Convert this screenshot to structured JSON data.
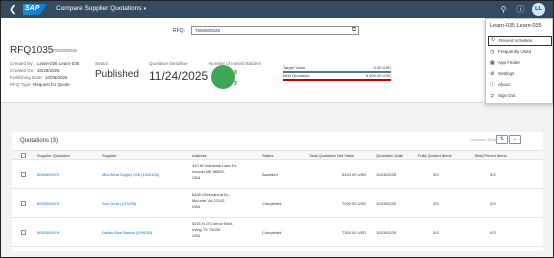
{
  "shell": {
    "back_icon": "back-arrow-icon",
    "logo_text": "SAP",
    "title": "Compare Supplier Quotations",
    "search_icon": "search-icon",
    "help_icon": "help-icon",
    "avatar_initials": "LL"
  },
  "header": {
    "rfq_label": "RFQ:",
    "rfq_value": "7000000025",
    "title": "RFQ1035",
    "subtitle": "7000000025",
    "created_by_label": "Created By:",
    "created_by_value": "Learn-035 Learn-035",
    "created_on_label": "Created On:",
    "created_on_value": "10/25/2025",
    "publishing_date_label": "Publishing Date:",
    "publishing_date_value": "10/25/2025",
    "rfq_type_label": "RFQ Type:",
    "rfq_type_value": "Request for Quote",
    "status_label": "Status:",
    "status_value": "Published",
    "deadline_label": "Quotation Deadline",
    "deadline_value": "11/24/2025",
    "bidders_label": "Number of Invited Bidders",
    "bidders_count_1": "3",
    "bidders_count_2": "3",
    "target_value_label": "Target Value",
    "target_value": "0.00 USD",
    "best_quotation_label": "Best Quotation",
    "best_quotation": "6,400.00 USD",
    "target_color": "#5b738b",
    "best_color": "#bb0000"
  },
  "table": {
    "title": "Quotations (3)",
    "compare_label": "Compare",
    "reset_label": "Reset",
    "columns": [
      "Supplier Quotation",
      "Supplier",
      "Address",
      "Status",
      "Total Quotation Net Value",
      "Quotation Date",
      "Fully Quoted Items",
      "Best-Priced Items"
    ],
    "rows": [
      {
        "quotation": "8000000072",
        "supplier": "Mid-West Supply 035 (1003163)",
        "address_1": "310 W Industrial Lake Dr,",
        "address_2": "Lincoln NE 68528,",
        "address_3": "USA",
        "status": "Awarded",
        "net_value": "6400.00 USD",
        "date": "10/25/2025",
        "fully_quoted": "3/3",
        "best_priced": "3/3"
      },
      {
        "quotation": "8000000073",
        "supplier": "Sun Gear (107035)",
        "address_1": "6405 Greenalond Dr.,",
        "address_2": "McLean VA 22102,",
        "address_3": "USA",
        "status": "Completed",
        "net_value": "7000.00 USD",
        "date": "10/25/2025",
        "fully_quoted": "3/3",
        "best_priced": "0/3"
      },
      {
        "quotation": "8000000074",
        "supplier": "Dallas Bike Basics (109035)",
        "address_1": "5215 N O'Connor Blvd,",
        "address_2": "Irving TX 75039,",
        "address_3": "USA",
        "status": "Completed",
        "net_value": "7300.00 USD",
        "date": "10/25/2025",
        "fully_quoted": "3/3",
        "best_priced": "0/3"
      }
    ]
  },
  "user_menu": {
    "header": "Learn-035 Learn-035",
    "items": [
      {
        "label": "Recent Activities",
        "icon": "history-icon"
      },
      {
        "label": "Frequently Used",
        "icon": "clock-icon"
      },
      {
        "label": "App Finder",
        "icon": "app-finder-icon"
      },
      {
        "label": "Settings",
        "icon": "gear-icon"
      },
      {
        "label": "About",
        "icon": "info-icon"
      },
      {
        "label": "Sign Out",
        "icon": "sign-out-icon"
      }
    ]
  }
}
